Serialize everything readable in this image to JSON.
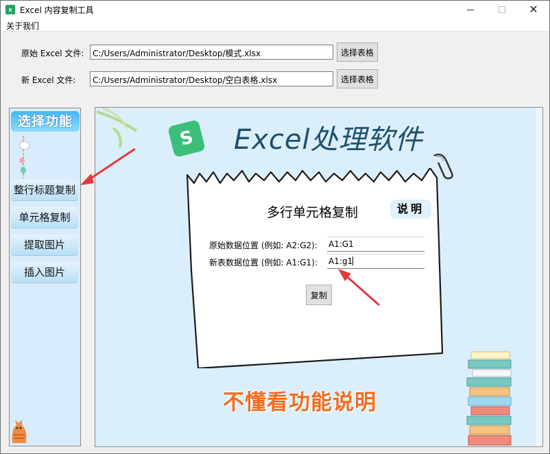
{
  "window": {
    "title": "Excel 内容复制工具",
    "app_icon": "excel-icon",
    "controls": [
      "minimize-icon",
      "maximize-icon",
      "close-icon"
    ],
    "close_glyph": "✕"
  },
  "menubar": {
    "items": [
      {
        "label": "关于我们"
      }
    ]
  },
  "files": {
    "original_label": "原始 Excel 文件:",
    "original_path": "C:/Users/Administrator/Desktop/模式.xlsx",
    "new_label": "新 Excel 文件:",
    "new_path": "C:/Users/Administrator/Desktop/空白表格.xlsx",
    "choose_label": "选择表格"
  },
  "sidebar": {
    "title": "选择功能",
    "items": [
      {
        "label": "整行标题复制"
      },
      {
        "label": "单元格复制"
      },
      {
        "label": "提取图片"
      },
      {
        "label": "插入图片"
      }
    ]
  },
  "main": {
    "logo_letter": "S",
    "title": "Excel处理软件",
    "card": {
      "heading": "多行单元格复制",
      "explain_label": "说明",
      "source_label": "原始数据位置 (例如: A2:G2):",
      "source_value": "A1:G1",
      "target_label": "新表数据位置 (例如: A1:G1):",
      "target_value": "A1:g1",
      "copy_label": "复制"
    },
    "footer": "不懂看功能说明"
  },
  "colors": {
    "accent": "#47b7f2",
    "panel_bg": "#dbeefc",
    "title": "#1f4f6b",
    "footer": "#f26d21",
    "arrow": "#e03a3a",
    "excel_green": "#21a366"
  }
}
